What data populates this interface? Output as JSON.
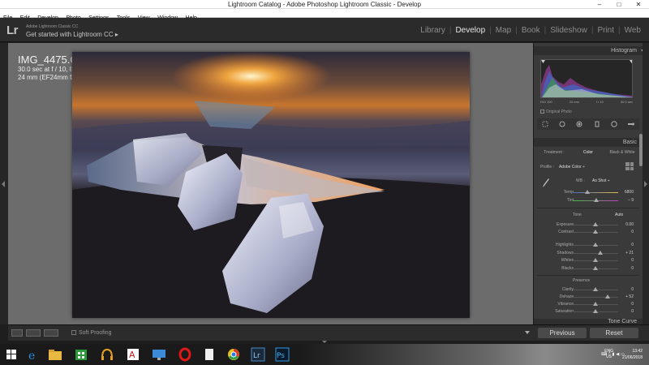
{
  "window": {
    "title": "Lightroom Catalog - Adobe Photoshop Lightroom Classic - Develop",
    "minimize_glyph": "–",
    "maximize_glyph": "□",
    "close_glyph": "✕"
  },
  "menu": [
    "File",
    "Edit",
    "Develop",
    "Photo",
    "Settings",
    "Tools",
    "View",
    "Window",
    "Help"
  ],
  "identity": {
    "logo": "Lr",
    "line1": "Adobe Lightroom Classic CC",
    "line2": "Get started with Lightroom CC  ▸"
  },
  "modules": [
    "Library",
    "Develop",
    "Map",
    "Book",
    "Slideshow",
    "Print",
    "Web"
  ],
  "active_module": "Develop",
  "photo_info": {
    "filename": "IMG_4475.CR2",
    "exposure": "30.0 sec at f / 10, ISO 100",
    "lens": "24 mm (EF24mm f/1.4L II USM)"
  },
  "histogram": {
    "title": "Histogram",
    "iso": "ISO 100",
    "focal": "24 mm",
    "aperture": "f / 10",
    "shutter": "30.0 sec",
    "original_photo": "Original Photo"
  },
  "basic": {
    "title": "Basic",
    "tabs": [
      "Treatment :",
      "Color",
      "Black & White"
    ],
    "active_tab": "Color",
    "profile_label": "Profile :",
    "profile_value": "Adobe Color ÷",
    "wb_label": "WB :",
    "wb_value": "As Shot ÷",
    "temp_label": "Temp",
    "temp_value": "6800",
    "tint_label": "Tint",
    "tint_value": "– 9",
    "tone_label": "Tone",
    "auto_label": "Auto",
    "sliders": [
      {
        "label": "Exposure",
        "value": "0.00",
        "pos": 0.5
      },
      {
        "label": "Contrast",
        "value": "0",
        "pos": 0.5
      },
      {
        "label": "Highlights",
        "value": "0",
        "pos": 0.5
      },
      {
        "label": "Shadows",
        "value": "+ 21",
        "pos": 0.6
      },
      {
        "label": "Whites",
        "value": "0",
        "pos": 0.5
      },
      {
        "label": "Blacks",
        "value": "0",
        "pos": 0.5
      }
    ],
    "presence_label": "Presence",
    "presence": [
      {
        "label": "Clarity",
        "value": "0",
        "pos": 0.5
      },
      {
        "label": "Dehaze",
        "value": "+ 52",
        "pos": 0.76
      },
      {
        "label": "Vibrance",
        "value": "0",
        "pos": 0.5
      },
      {
        "label": "Saturation",
        "value": "0",
        "pos": 0.5
      }
    ],
    "next_panel": "Tone Curve"
  },
  "toolbar": {
    "soft_proofing": "Soft Proofing"
  },
  "buttons": {
    "previous": "Previous",
    "reset": "Reset"
  },
  "taskbar": {
    "lang": "ENG",
    "region": "US",
    "time": "13:42",
    "date": "21/06/2018"
  }
}
